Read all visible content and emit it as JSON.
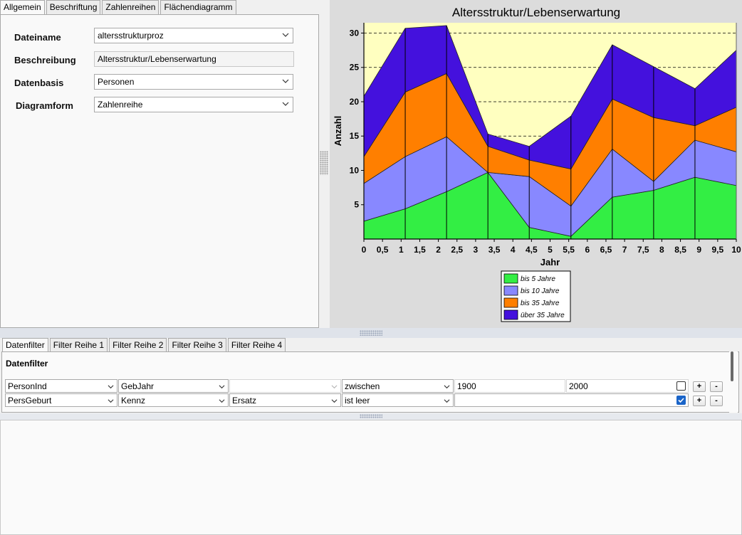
{
  "top_tabs": [
    {
      "label": "Allgemein",
      "active": true
    },
    {
      "label": "Beschriftung",
      "active": false
    },
    {
      "label": "Zahlenreihen",
      "active": false
    },
    {
      "label": "Flächendiagramm",
      "active": false
    }
  ],
  "form": {
    "dateiname_label": "Dateiname",
    "dateiname_value": "altersstrukturproz",
    "beschreibung_label": "Beschreibung",
    "beschreibung_value": "Altersstruktur/Lebenserwartung",
    "datenbasis_label": "Datenbasis",
    "datenbasis_value": "Personen",
    "diagramform_label": "Diagramform",
    "diagramform_value": "Zahlenreihe"
  },
  "chart_data": {
    "type": "area",
    "stacked": true,
    "title": "Altersstruktur/Lebenserwartung",
    "xlabel": "Jahr",
    "ylabel": "Anzahl",
    "xlim": [
      0,
      10
    ],
    "ylim": [
      0,
      31.5
    ],
    "x_ticks": [
      "0",
      "0,5",
      "1",
      "1,5",
      "2",
      "2,5",
      "3",
      "3,5",
      "4",
      "4,5",
      "5",
      "5,5",
      "6",
      "6,5",
      "7",
      "7,5",
      "8",
      "8,5",
      "9",
      "9,5",
      "10"
    ],
    "y_ticks": [
      5,
      10,
      15,
      20,
      25,
      30
    ],
    "grid": "horizontal-dashed",
    "background_color": "#ffffc0",
    "legend_position": "bottom",
    "x": [
      0,
      1.11,
      2.22,
      3.33,
      4.44,
      5.56,
      6.67,
      7.78,
      8.89,
      10
    ],
    "series": [
      {
        "name": "bis 5 Jahre",
        "color": "#33ee44",
        "values": [
          2.6,
          4.4,
          6.9,
          9.7,
          1.7,
          0.4,
          6.1,
          7.1,
          9.0,
          7.8
        ]
      },
      {
        "name": "bis 10 Jahre",
        "color": "#8888ff",
        "values": [
          5.5,
          7.6,
          8.0,
          0.0,
          7.4,
          4.4,
          7.0,
          1.3,
          5.4,
          4.9
        ]
      },
      {
        "name": "bis 35 Jahre",
        "color": "#ff7f00",
        "values": [
          3.9,
          9.4,
          9.2,
          3.8,
          2.4,
          5.4,
          7.3,
          9.3,
          2.1,
          6.5
        ]
      },
      {
        "name": "über 35 Jahre",
        "color": "#4411dd",
        "values": [
          8.8,
          9.3,
          7.0,
          1.8,
          2.0,
          7.7,
          7.9,
          7.4,
          5.4,
          8.3
        ]
      }
    ]
  },
  "filter_tabs": [
    {
      "label": "Datenfilter",
      "active": true
    },
    {
      "label": "Filter Reihe 1",
      "active": false
    },
    {
      "label": "Filter Reihe 2",
      "active": false
    },
    {
      "label": "Filter Reihe 3",
      "active": false
    },
    {
      "label": "Filter Reihe 4",
      "active": false
    }
  ],
  "filter": {
    "title": "Datenfilter",
    "rows": [
      {
        "field1": "PersonInd",
        "field2": "GebJahr",
        "field3": "",
        "operator": "zwischen",
        "value1": "1900",
        "value2": "2000",
        "checked": false,
        "plus": "+",
        "minus": "-"
      },
      {
        "field1": "PersGeburt",
        "field2": "Kennz",
        "field3": "Ersatz",
        "operator": "ist leer",
        "value1": "",
        "value2": "",
        "checked": true,
        "plus": "+",
        "minus": "-"
      }
    ]
  }
}
